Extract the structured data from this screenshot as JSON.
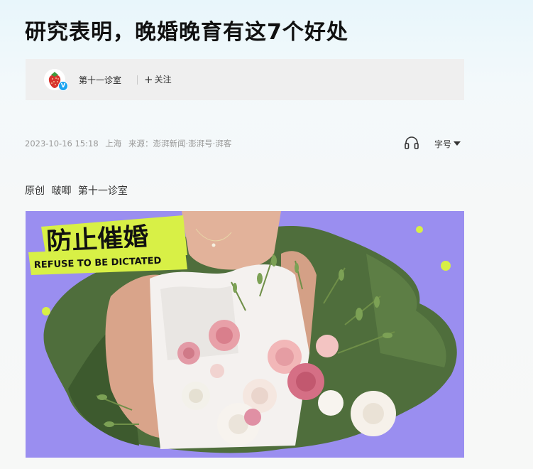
{
  "article": {
    "title": "研究表明，晚婚晚育有这7个好处",
    "author": {
      "name": "第十一诊室",
      "avatar_icon": "strawberry-avatar",
      "verified_badge": "V"
    },
    "follow_button": {
      "icon": "plus-icon",
      "label": "关注"
    },
    "meta": {
      "datetime": "2023-10-16 15:18",
      "location": "上海",
      "source": "来源：澎湃新闻·澎湃号·湃客"
    },
    "toolbar": {
      "listen_icon": "headphone-icon",
      "font_size_label": "字号",
      "font_size_icon": "caret-down-icon"
    },
    "byline": {
      "original": "原创",
      "writer": "啵唧",
      "column": "第十一诊室"
    },
    "hero_image": {
      "badge_cn": "防止催婚",
      "badge_en": "REFUSE TO BE DICTATED",
      "background_color": "#9a8ef0",
      "badge_color": "#d8f046"
    }
  }
}
